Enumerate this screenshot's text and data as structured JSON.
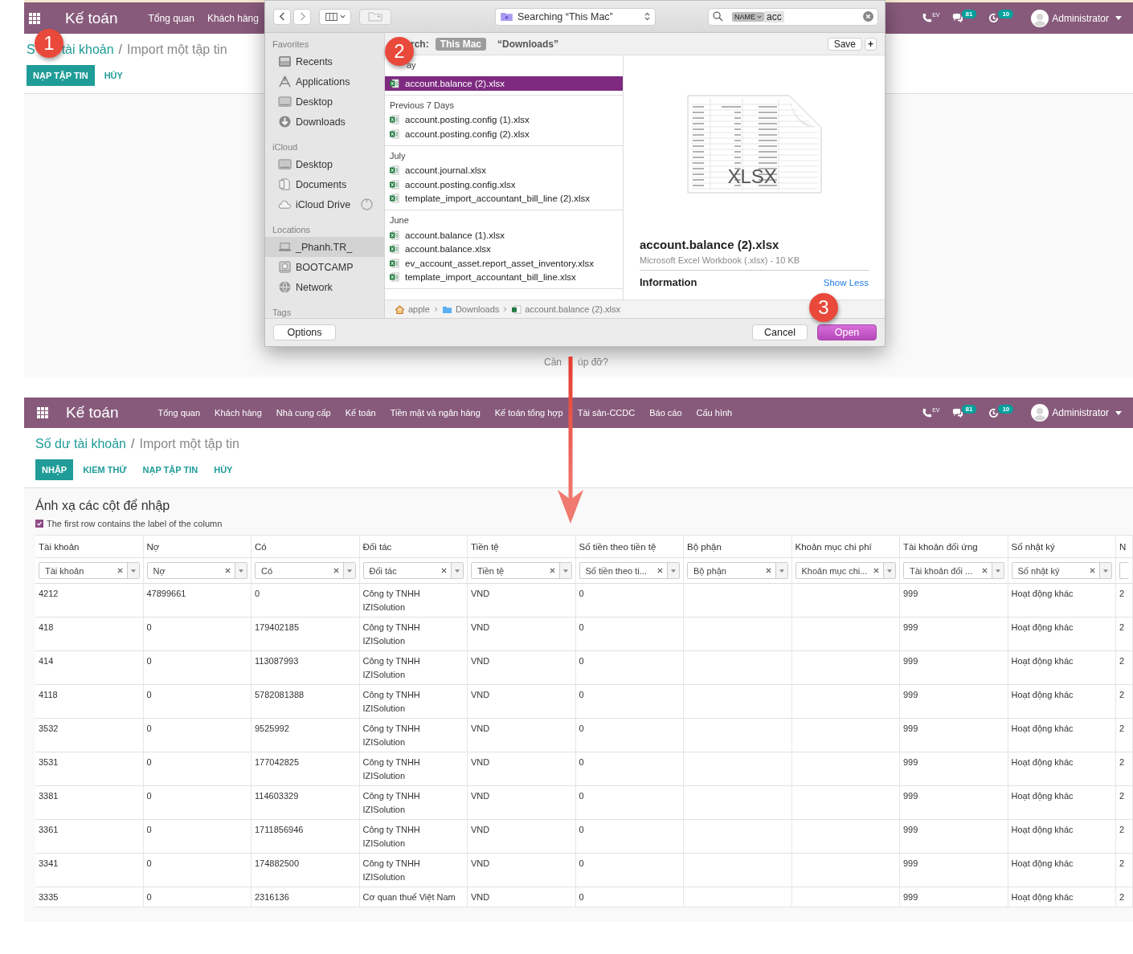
{
  "top": {
    "navbar": {
      "app": "Kế toán",
      "menu": [
        "Tổng quan",
        "Khách hàng"
      ],
      "phone_label": "EV",
      "messages": "81",
      "activities": "10",
      "user": "Administrator"
    },
    "breadcrumb": {
      "parent_parts": [
        "S",
        "tài khoản"
      ],
      "separator": "/",
      "current": "Import một tập tin"
    },
    "buttons": [
      {
        "label": "NẠP TẬP TIN",
        "kind": "primary"
      },
      {
        "label": "HỦY",
        "kind": "link"
      }
    ],
    "help_parts": [
      "Cần",
      "úp đỡ?"
    ]
  },
  "dialog": {
    "toolbar": {
      "location": "Searching “This Mac”",
      "search_token": "NAME",
      "search_text": "acc"
    },
    "scope": {
      "label": "rch:",
      "options": [
        {
          "label": "This Mac",
          "selected": true
        },
        {
          "label": "“Downloads”",
          "selected": false
        }
      ],
      "buttons": [
        {
          "label": "Save",
          "kind": "save"
        },
        {
          "label": "+",
          "kind": "add"
        }
      ]
    },
    "sidebar": [
      {
        "title": "Favorites",
        "items": [
          {
            "label": "Recents",
            "kind": "recents",
            "selected": false
          },
          {
            "label": "Applications",
            "kind": "applications",
            "selected": false
          },
          {
            "label": "Desktop",
            "kind": "desktop",
            "selected": false
          },
          {
            "label": "Downloads",
            "kind": "downloads",
            "selected": false
          }
        ]
      },
      {
        "title": "iCloud",
        "items": [
          {
            "label": "Desktop",
            "kind": "desktop",
            "selected": false
          },
          {
            "label": "Documents",
            "kind": "documents",
            "selected": false
          },
          {
            "label": "iCloud Drive",
            "kind": "cloud",
            "selected": false
          }
        ]
      },
      {
        "title": "Locations",
        "items": [
          {
            "label": "_Phanh.TR_",
            "kind": "laptop",
            "selected": true
          },
          {
            "label": "BOOTCAMP",
            "kind": "disk",
            "selected": false
          },
          {
            "label": "Network",
            "kind": "network",
            "selected": false
          }
        ]
      },
      {
        "title": "Tags"
      }
    ],
    "groups": [
      {
        "title": "ay",
        "files": [
          {
            "name": "account.balance (2).xlsx",
            "selected": true
          }
        ]
      },
      {
        "title": "Previous 7 Days",
        "files": [
          {
            "name": "account.posting.config (1).xlsx",
            "selected": false
          },
          {
            "name": "account.posting.config (2).xlsx",
            "selected": false
          }
        ]
      },
      {
        "title": "July",
        "files": [
          {
            "name": "account.journal.xlsx",
            "selected": false
          },
          {
            "name": "account.posting.config.xlsx",
            "selected": false
          },
          {
            "name": "template_import_accountant_bill_line (2).xlsx",
            "selected": false
          }
        ]
      },
      {
        "title": "June",
        "files": [
          {
            "name": "account.balance (1).xlsx",
            "selected": false
          },
          {
            "name": "account.balance.xlsx",
            "selected": false
          },
          {
            "name": "ev_account_asset.report_asset_inventory.xlsx",
            "selected": false
          },
          {
            "name": "template_import_accountant_bill_line.xlsx",
            "selected": false
          }
        ]
      }
    ],
    "path": [
      {
        "label": "apple",
        "kind": "home"
      },
      {
        "label": "Downloads",
        "kind": "folder"
      },
      {
        "label": "account.balance (2).xlsx",
        "kind": "file"
      }
    ],
    "preview": {
      "thumb_label": "XLSX",
      "name": "account.balance (2).xlsx",
      "details": "Microsoft Excel Workbook (.xlsx) - 10 KB",
      "info_title": "Information",
      "info_toggle": "Show Less"
    },
    "footer": {
      "options": "Options",
      "cancel": "Cancel",
      "open": "Open"
    }
  },
  "steps": [
    "1",
    "2",
    "3"
  ],
  "bottom": {
    "navbar": {
      "app": "Kế toán",
      "menu": [
        "Tổng quan",
        "Khách hàng",
        "Nhà cung cấp",
        "Kế toán",
        "Tiền mặt và ngân hàng",
        "Kế toán tổng hợp",
        "Tài sản-CCDC",
        "Báo cáo",
        "Cấu hình"
      ],
      "phone_label": "EV",
      "messages": "81",
      "activities": "10",
      "user": "Administrator"
    },
    "breadcrumb": {
      "parent": "Số dư tài khoản",
      "separator": "/",
      "current": "Import một tập tin"
    },
    "buttons": [
      {
        "label": "NHẬP",
        "kind": "primary"
      },
      {
        "label": "KIỂM THỬ",
        "kind": "link"
      },
      {
        "label": "NẠP TẬP TIN",
        "kind": "link"
      },
      {
        "label": "HỦY",
        "kind": "link"
      }
    ],
    "mapping": {
      "title": "Ánh xạ các cột để nhập",
      "first_row_header": {
        "label": "The first row contains the label of the column",
        "checked": true
      },
      "columns": [
        {
          "header": "Tài khoản",
          "field": "Tài khoản"
        },
        {
          "header": "Nợ",
          "field": "Nợ"
        },
        {
          "header": "Có",
          "field": "Có"
        },
        {
          "header": "Đối tác",
          "field": "Đối tác"
        },
        {
          "header": "Tiền tệ",
          "field": "Tiền tệ"
        },
        {
          "header": "Số tiền theo tiền tệ",
          "field": "Số tiền theo ti..."
        },
        {
          "header": "Bộ phận",
          "field": "Bộ phận"
        },
        {
          "header": "Khoản mục chi phí",
          "field": "Khoản mục chi..."
        },
        {
          "header": "Tài khoản đối ứng",
          "field": "Tài khoản đối ..."
        },
        {
          "header": "Số nhật ký",
          "field": "Số nhật ký"
        },
        {
          "header": "N"
        }
      ],
      "rows": [
        [
          "4212",
          "47899661",
          "0",
          "Công ty TNHH IZISolution",
          "VND",
          "0",
          null,
          null,
          "999",
          "Hoạt động khác",
          "2"
        ],
        [
          "418",
          "0",
          "179402185",
          "Công ty TNHH IZISolution",
          "VND",
          "0",
          null,
          null,
          "999",
          "Hoạt động khác",
          "2"
        ],
        [
          "414",
          "0",
          "113087993",
          "Công ty TNHH IZISolution",
          "VND",
          "0",
          null,
          null,
          "999",
          "Hoạt động khác",
          "2"
        ],
        [
          "4118",
          "0",
          "5782081388",
          "Công ty TNHH IZISolution",
          "VND",
          "0",
          null,
          null,
          "999",
          "Hoạt động khác",
          "2"
        ],
        [
          "3532",
          "0",
          "9525992",
          "Công ty TNHH IZISolution",
          "VND",
          "0",
          null,
          null,
          "999",
          "Hoạt động khác",
          "2"
        ],
        [
          "3531",
          "0",
          "177042825",
          "Công ty TNHH IZISolution",
          "VND",
          "0",
          null,
          null,
          "999",
          "Hoạt động khác",
          "2"
        ],
        [
          "3381",
          "0",
          "114603329",
          "Công ty TNHH IZISolution",
          "VND",
          "0",
          null,
          null,
          "999",
          "Hoạt động khác",
          "2"
        ],
        [
          "3361",
          "0",
          "1711856946",
          "Công ty TNHH IZISolution",
          "VND",
          "0",
          null,
          null,
          "999",
          "Hoạt động khác",
          "2"
        ],
        [
          "3341",
          "0",
          "174882500",
          "Công ty TNHH IZISolution",
          "VND",
          "0",
          null,
          null,
          "999",
          "Hoạt động khác",
          "2"
        ],
        [
          "3335",
          "0",
          "2316136",
          "Cơ quan thuế Việt Nam",
          "VND",
          "0",
          null,
          null,
          "999",
          "Hoạt động khác",
          "2"
        ]
      ]
    }
  }
}
